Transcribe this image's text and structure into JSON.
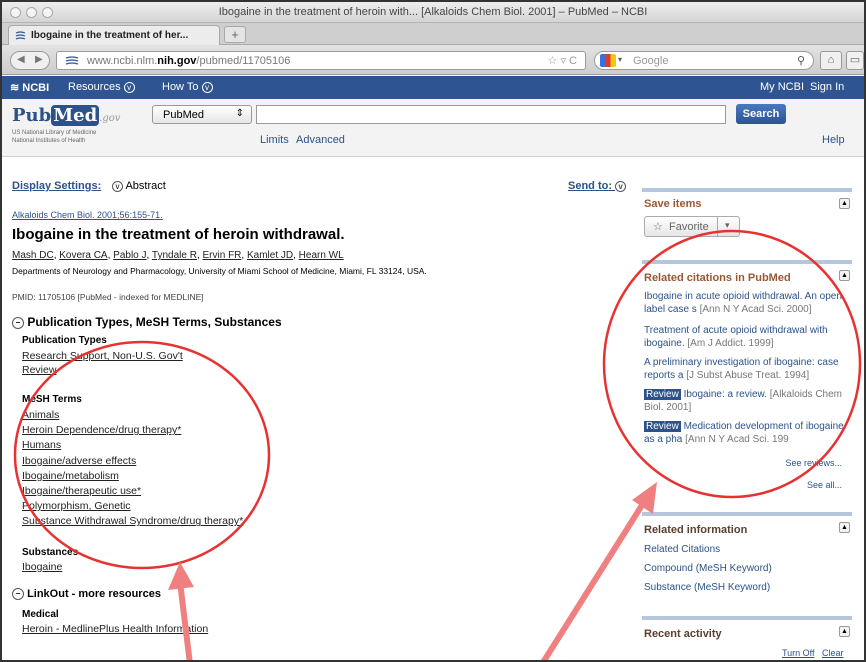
{
  "window": {
    "title": "Ibogaine in the treatment of heroin with... [Alkaloids Chem Biol. 2001] – PubMed – NCBI"
  },
  "tab": {
    "label": "Ibogaine in the treatment of her...",
    "new_tab": "+"
  },
  "nav": {
    "url_prefix": "www.ncbi.nlm.",
    "url_domain": "nih.gov",
    "url_path": "/pubmed/11705106",
    "url_right": "☆ ▿ C",
    "search_engine": "Google",
    "search_icon": "search-icon"
  },
  "ncbi": {
    "logo": "NCBI",
    "resources": "Resources",
    "howto": "How To",
    "my_ncbi": "My NCBI",
    "sign_in": "Sign In"
  },
  "pubmed": {
    "logo_pub": "Pub",
    "logo_med": "Med",
    "logo_gov": ".gov",
    "sub1": "US National Library of Medicine",
    "sub2": "National Institutes of Health",
    "db_value": "PubMed",
    "search_button": "Search",
    "limits": "Limits",
    "advanced": "Advanced",
    "help": "Help"
  },
  "article": {
    "display_settings": "Display Settings:",
    "display_value": "Abstract",
    "send_to": "Send to:",
    "citation": "Alkaloids Chem Biol. 2001;56:155-71.",
    "title": "Ibogaine in the treatment of heroin withdrawal.",
    "authors": [
      "Mash DC",
      "Kovera CA",
      "Pablo J",
      "Tyndale R",
      "Ervin FR",
      "Kamlet JD",
      "Hearn WL"
    ],
    "affiliation": "Departments of Neurology and Pharmacology, University of Miami School of Medicine, Miami, FL 33124, USA.",
    "pmid": "PMID: 11705106 [PubMed - indexed for MEDLINE]"
  },
  "mesh_section": {
    "heading": "Publication Types, MeSH Terms, Substances",
    "pub_types_label": "Publication Types",
    "pub_types": [
      "Research Support, Non-U.S. Gov't",
      "Review"
    ],
    "mesh_label": "MeSH Terms",
    "mesh_terms": [
      "Animals",
      "Heroin Dependence/drug therapy*",
      "Humans",
      "Ibogaine/adverse effects",
      "Ibogaine/metabolism",
      "Ibogaine/therapeutic use*",
      "Polymorphism, Genetic",
      "Substance Withdrawal Syndrome/drug therapy*"
    ],
    "substances_label": "Substances",
    "substances": [
      "Ibogaine"
    ]
  },
  "linkout": {
    "heading": "LinkOut - more resources",
    "medical_label": "Medical",
    "medical_link": "Heroin - MedlinePlus Health Information"
  },
  "sidebar": {
    "save_items": "Save items",
    "favorite": "Favorite",
    "related_heading": "Related citations in PubMed",
    "related": [
      {
        "title": "Ibogaine in acute opioid withdrawal. An open label case s",
        "journal": "[Ann N Y Acad Sci. 2000]",
        "review": ""
      },
      {
        "title": "Treatment of acute opioid withdrawal with ibogaine.",
        "journal": "[Am J Addict. 1999]",
        "review": ""
      },
      {
        "title": "A preliminary investigation of ibogaine: case reports a",
        "journal": "[J Subst Abuse Treat. 1994]",
        "review": ""
      },
      {
        "title": "Ibogaine: a review.",
        "journal": "[Alkaloids Chem Biol. 2001]",
        "review": "Review"
      },
      {
        "title": "Medication development of ibogaine as a pha",
        "journal": "[Ann N Y Acad Sci. 199",
        "review": "Review"
      }
    ],
    "see_reviews": "See reviews...",
    "see_all": "See all...",
    "related_info_heading": "Related information",
    "related_info": [
      "Related Citations",
      "Compound (MeSH Keyword)",
      "Substance (MeSH Keyword)"
    ],
    "recent_heading": "Recent activity",
    "turn_off": "Turn Off",
    "clear": "Clear"
  },
  "colors": {
    "ncbi_bar": "#2e5592",
    "link": "#2c5289",
    "annotation": "#f08080",
    "panel_heading": "#985735"
  }
}
